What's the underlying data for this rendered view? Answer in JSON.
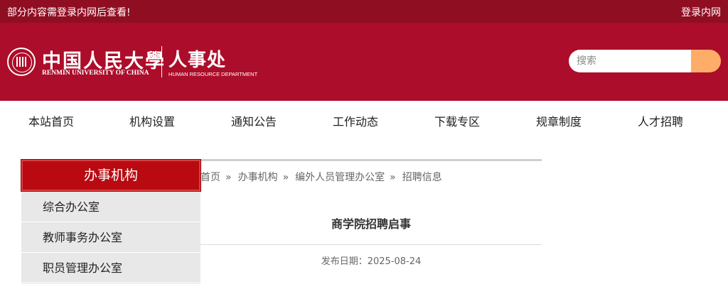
{
  "topbar": {
    "notice": "部分内容需登录内网后查看!",
    "login_link": "登录内网"
  },
  "header": {
    "logo_cn": "中国人民大學",
    "logo_en": "RENMIN UNIVERSITY OF CHINA",
    "dept_cn": "人事处",
    "dept_en": "HUMAN RESOURCE DEPARTMENT"
  },
  "search": {
    "placeholder": "搜索"
  },
  "nav": {
    "items": [
      {
        "label": "本站首页"
      },
      {
        "label": "机构设置"
      },
      {
        "label": "通知公告"
      },
      {
        "label": "工作动态"
      },
      {
        "label": "下载专区"
      },
      {
        "label": "规章制度"
      },
      {
        "label": "人才招聘"
      }
    ]
  },
  "sidebar": {
    "title": "办事机构",
    "items": [
      {
        "label": "综合办公室"
      },
      {
        "label": "教师事务办公室"
      },
      {
        "label": "职员管理办公室"
      }
    ]
  },
  "breadcrumb": {
    "items": [
      "首页",
      "办事机构",
      "编外人员管理办公室",
      "招聘信息"
    ],
    "separator": "»"
  },
  "article": {
    "title": "商学院招聘启事",
    "date_label": "发布日期：2025-08-24"
  },
  "colors": {
    "topbar": "#8f0e22",
    "header": "#ac0d2a",
    "search_button": "#fdad68",
    "sidebar_title": "#b80a10",
    "sidebar_bg": "#e8e8e8"
  }
}
